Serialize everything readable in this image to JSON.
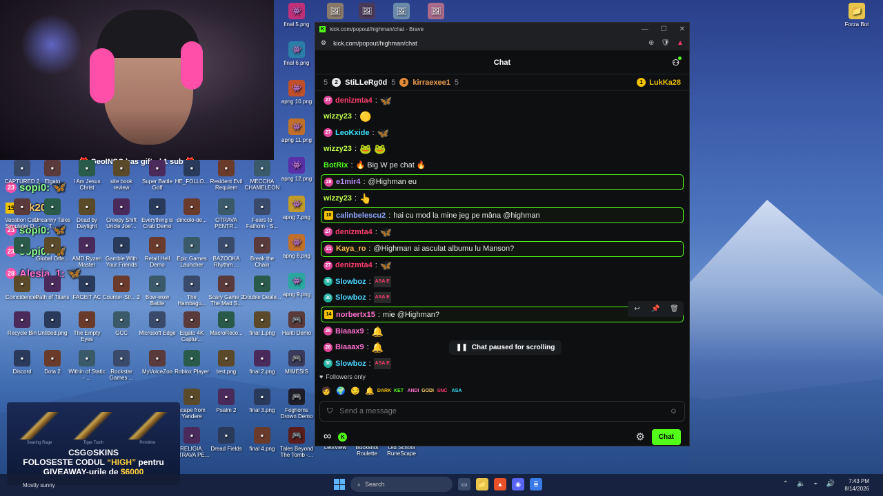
{
  "browser": {
    "tab_title": "kick.com/popout/highman/chat - Brave",
    "url": "kick.com/popout/highman/chat"
  },
  "chat": {
    "header": "Chat",
    "leaderboard": [
      {
        "rank": "5",
        "name": "",
        "count": ""
      },
      {
        "rank": "2",
        "name": "StiLLeRg0d",
        "count": "5"
      },
      {
        "rank": "3",
        "name": "kirraexee1",
        "count": "5"
      }
    ],
    "leader_top": {
      "rank": "1",
      "name": "LukKa28"
    },
    "messages": [
      {
        "badge": "27",
        "name": "denizmta4",
        "color": "#ff3d6e",
        "text": "",
        "emote": "🦋"
      },
      {
        "badge": "",
        "name": "wizzy23",
        "color": "#c2ff4a",
        "text": "",
        "emote": "🟡"
      },
      {
        "badge": "27",
        "name": "LeoKxide",
        "color": "#39e6ff",
        "text": "",
        "emote": "🦋"
      },
      {
        "badge": "",
        "name": "wizzy23",
        "color": "#c2ff4a",
        "text": "",
        "emote": "🐸 🐸"
      },
      {
        "badge": "",
        "name": "BotRix",
        "color": "#53fc18",
        "text": "🔥 Big W pe chat 🔥",
        "emote": ""
      },
      {
        "badge": "28",
        "name": "e1mir4",
        "color": "#b98cff",
        "text": "@Highman eu",
        "emote": "",
        "highlight": true
      },
      {
        "badge": "",
        "name": "wizzy23",
        "color": "#c2ff4a",
        "text": "",
        "emote": "👆"
      },
      {
        "badge": "10",
        "name": "calinbelescu2",
        "color": "#8ea3ff",
        "text": "hai cu mod la mine jeg pe mâna @highman",
        "emote": "",
        "highlight": true
      },
      {
        "badge": "27",
        "name": "denizmta4",
        "color": "#ff3d6e",
        "text": "",
        "emote": "🦋"
      },
      {
        "badge": "21",
        "name": "Kaya_ro",
        "color": "#ffb84a",
        "text": "@Highman ai asculat albumu lu Manson?",
        "emote": "",
        "highlight": true
      },
      {
        "badge": "27",
        "name": "denizmta4",
        "color": "#ff3d6e",
        "text": "",
        "emote": "🦋"
      },
      {
        "badge": "30",
        "name": "Slowboz",
        "color": "#4ad6ff",
        "text": "",
        "emote": "ASA E"
      },
      {
        "badge": "30",
        "name": "Slowboz",
        "color": "#4ad6ff",
        "text": "",
        "emote": "ASA E"
      },
      {
        "badge": "14",
        "name": "norbertx15",
        "color": "#ff6fd0",
        "text": "mie @Highman?",
        "emote": "",
        "highlight": true
      },
      {
        "badge": "28",
        "name": "Biaaax9",
        "color": "#ff6fd0",
        "text": "",
        "emote": "🔔"
      },
      {
        "badge": "28",
        "name": "Biaaax9",
        "color": "#ff6fd0",
        "text": "",
        "emote": "🔔"
      },
      {
        "badge": "30",
        "name": "Slowboz",
        "color": "#4ad6ff",
        "text": "",
        "emote": "ASA E"
      }
    ],
    "paused_label": "Chat paused for scrolling",
    "followers_only": "Followers only",
    "input_placeholder": "Send a message",
    "send_label": "Chat"
  },
  "overlay": {
    "gift_text": "GeoINSC has gifted 1 sub",
    "lines": [
      {
        "badge": "23",
        "name": "sopi0:"
      },
      {
        "badge": "15",
        "name": "crk20:"
      },
      {
        "badge": "23",
        "name": "sopi0:"
      },
      {
        "badge": "23",
        "name": "sopi0:"
      },
      {
        "badge": "28",
        "name": "Alesia_1:"
      }
    ]
  },
  "desktop_icons": [
    {
      "label": "final 5.png",
      "col": 0
    },
    {
      "label": "final 6.png",
      "col": 0
    },
    {
      "label": "apng 10.png",
      "col": 0
    },
    {
      "label": "apng 11.png",
      "col": 0
    },
    {
      "label": "apng 12.png",
      "col": 0
    },
    {
      "label": "apng 7.png",
      "col": 0
    },
    {
      "label": "apng 8.png",
      "col": 0
    },
    {
      "label": "apng 9.png",
      "col": 0
    },
    {
      "label": "Hariti Demo",
      "col": 0
    },
    {
      "label": "MIMESIS",
      "col": 0
    },
    {
      "label": "Foghorns Drown Demo",
      "col": 0
    },
    {
      "label": "Tales Beyond The Tomb -...",
      "col": 0
    }
  ],
  "desktop_grid": [
    [
      "CAPTURED 2",
      "Elgato",
      "I Am Jesus Christ",
      "site book review",
      "Super Battle Golf",
      "HE_FOLLO...",
      "Resident Evil Requiem",
      "MECCHA CHAMELEON"
    ],
    [
      "Vacation Cafe Simulator D...",
      "Uncanny Tales T...",
      "Dead by Daylight",
      "Creepy Shift Uncle Joe'...",
      "Everything is Crab Demo",
      "dincolo-de...",
      "OTRAVA PENTR...",
      "Fears to Fathom - S...",
      "Break the Chain"
    ],
    [
      "",
      "Global Offe...",
      "AMD Ryzen Master",
      "Gamble With Your Friends",
      "Retail Hell Demo",
      "Epic Games Launcher",
      "BAZOOKA Rhythm ...",
      "Break the Chain"
    ],
    [
      "Coincidences",
      "Path of Titans",
      "FACEIT AC",
      "Counter-Str... 2",
      "Bow-wow Battle",
      "The Hambagu...",
      "Scary Game 2 The Mad S...",
      "Double Deale..."
    ],
    [
      "Recycle Bin",
      "Untitled.png",
      "The Empty Eyes",
      "GCC",
      "Microsoft Edge",
      "Elgato 4K Captur...",
      "MacroReco...",
      "final 1.png"
    ],
    [
      "Discord",
      "Dota 2",
      "Within of Static - ...",
      "Rockstar Games ...",
      "MyVoiceZoo",
      "Roblox Player",
      "test.png",
      "final 2.png"
    ],
    [
      "",
      "",
      "",
      "",
      "",
      "scape from Yandere",
      "Psalm 2",
      "final 3.png"
    ],
    [
      "",
      "",
      "",
      "",
      "",
      "RELIGIA. OTRAVA PE...",
      "Dread Fields",
      "final 4.png"
    ]
  ],
  "bottom_labels": [
    "LetsView",
    "Buckshot Roulette",
    "Old School RuneScape"
  ],
  "forza": "Forza Bot",
  "promo": {
    "guns": [
      "Searing Rage",
      "Tiger Tooth",
      "Primitive"
    ],
    "brand": "CSG⊙SKINS",
    "line1_a": "FOLOSESTE CODUL ",
    "line1_code": "“HIGH”",
    "line1_b": " pentru",
    "line2_a": "GIVEAWAY-urile de ",
    "line2_amount": "$6000"
  },
  "taskbar": {
    "weather": "Mostly sunny",
    "search": "Search",
    "time": "7:43 PM",
    "date": "8/14/2026"
  },
  "colors": {
    "accent": "#53fc18",
    "panel": "#0d0f11"
  }
}
